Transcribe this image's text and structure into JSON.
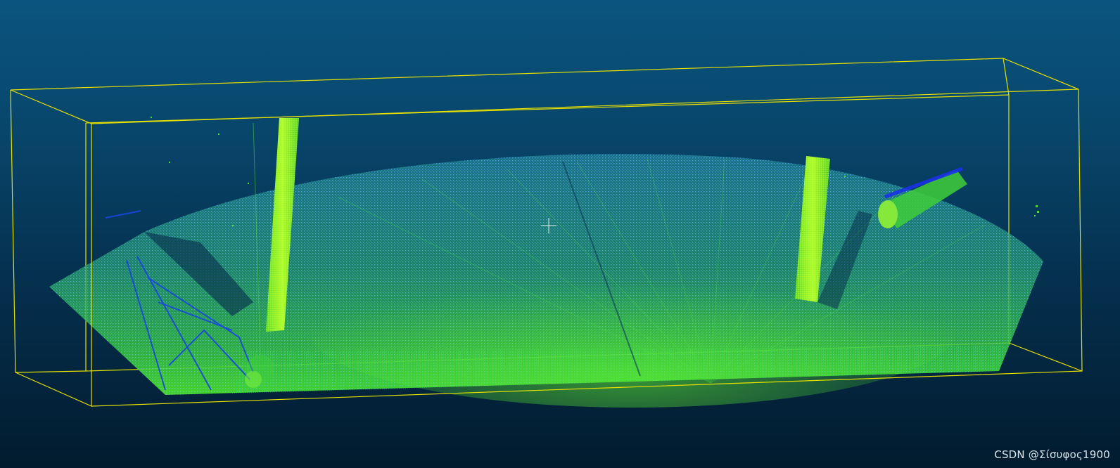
{
  "viewer": {
    "watermark": "CSDN @Σίσυφος1900",
    "background_colors": [
      "#0a5580",
      "#021b2e"
    ],
    "bounding_box_color": "#e6e000",
    "crosshair_color": "#e8eef4",
    "point_color_scale": [
      "#1030e0",
      "#1f78b4",
      "#24b0a0",
      "#40d040",
      "#9cf020"
    ]
  }
}
